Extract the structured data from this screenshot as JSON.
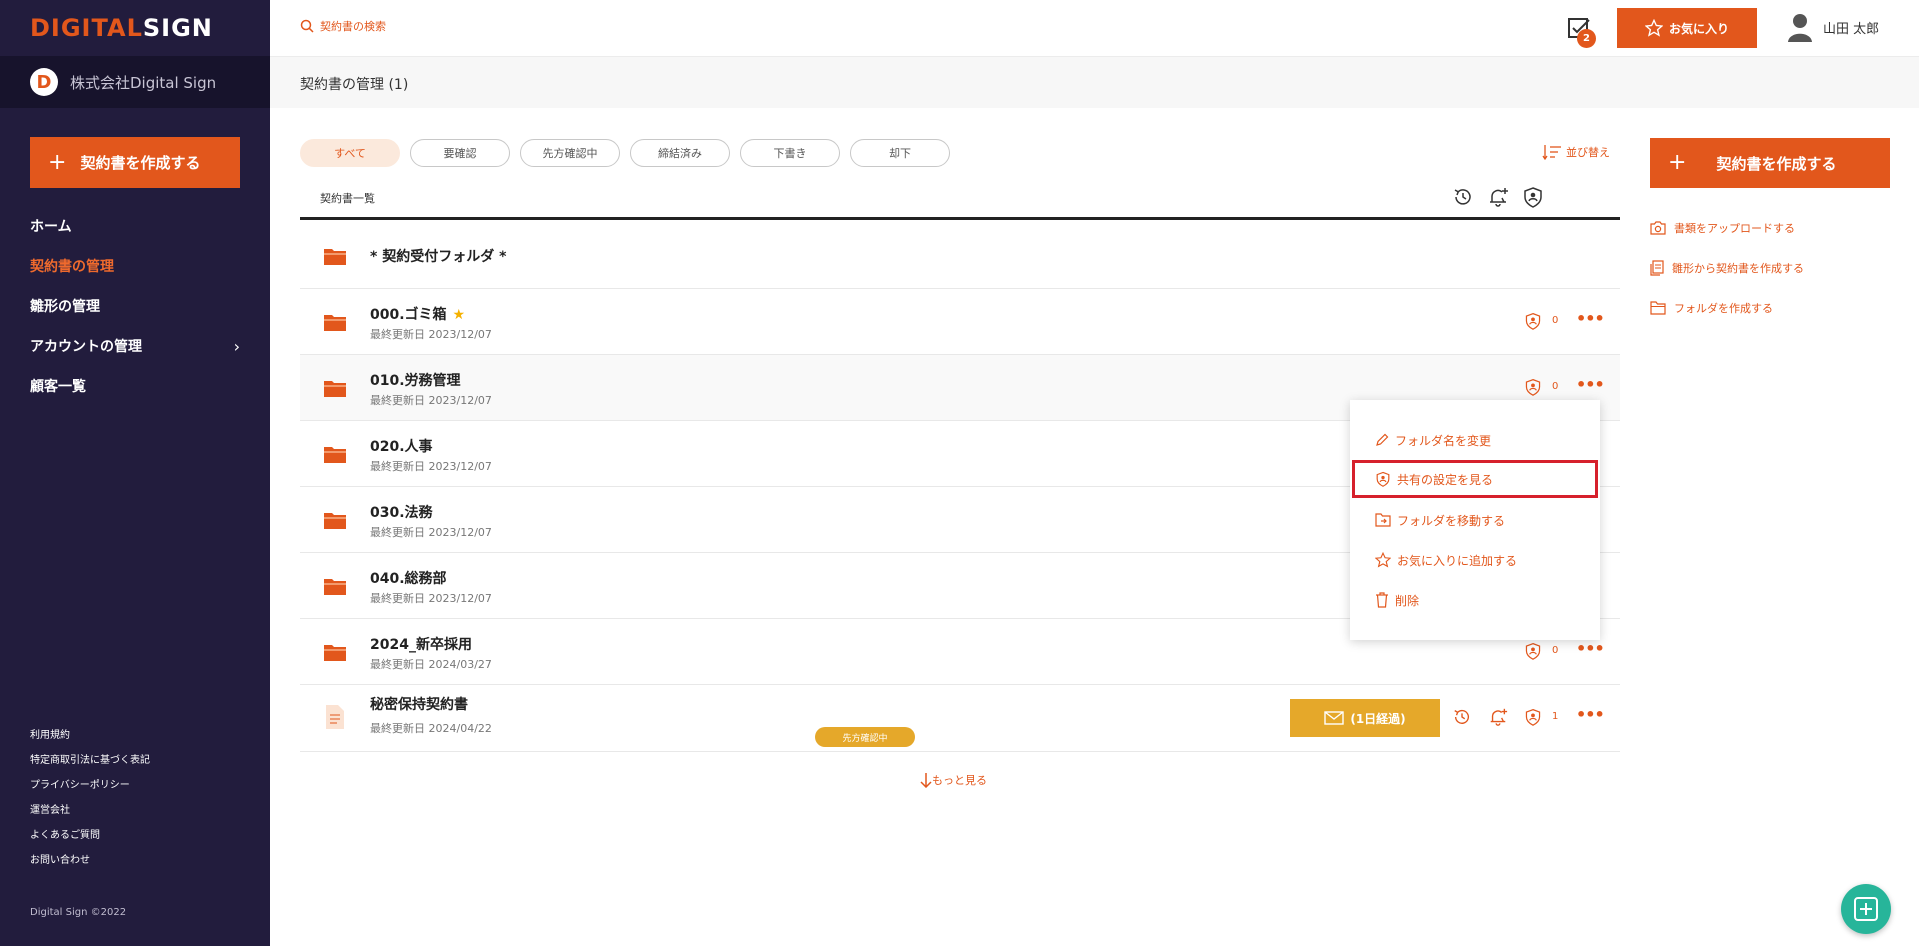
{
  "brand": {
    "logo_part1": "DIGITAL",
    "logo_part2": "SIGN",
    "company_initial": "D",
    "company_name": "株式会社Digital Sign",
    "accent_color": "#e2571c"
  },
  "sidebar": {
    "create_label": "契約書を作成する",
    "nav": [
      {
        "label": "ホーム",
        "active": false
      },
      {
        "label": "契約書の管理",
        "active": true
      },
      {
        "label": "雛形の管理",
        "active": false
      },
      {
        "label": "アカウントの管理",
        "active": false,
        "has_submenu": true
      },
      {
        "label": "顧客一覧",
        "active": false
      }
    ],
    "footer_links": [
      "利用規約",
      "特定商取引法に基づく表記",
      "プライバシーポリシー",
      "運営会社",
      "よくあるご質問",
      "お問い合わせ"
    ],
    "copyright": "Digital Sign ©2022"
  },
  "topbar": {
    "search_placeholder": "契約書の検索",
    "task_count": "2",
    "favorite_label": "お気に入り",
    "user_name": "山田 太郎"
  },
  "page": {
    "title": "契約書の管理 (1)"
  },
  "filters": [
    "すべて",
    "要確認",
    "先方確認中",
    "締結済み",
    "下書き",
    "却下"
  ],
  "sort_label": "並び替え",
  "list_header": "契約書一覧",
  "rows": [
    {
      "title": "* 契約受付フォルダ *",
      "date": ""
    },
    {
      "title": "000.ゴミ箱",
      "date": "最終更新日 2023/12/07",
      "starred": true,
      "share_count": "0"
    },
    {
      "title": "010.労務管理",
      "date": "最終更新日 2023/12/07",
      "share_count": "0"
    },
    {
      "title": "020.人事",
      "date": "最終更新日 2023/12/07",
      "share_count": "0"
    },
    {
      "title": "030.法務",
      "date": "最終更新日 2023/12/07",
      "share_count": "0"
    },
    {
      "title": "040.総務部",
      "date": "最終更新日 2023/12/07",
      "share_count": "0"
    },
    {
      "title": "2024_新卒採用",
      "date": "最終更新日 2024/03/27",
      "share_count": "0"
    },
    {
      "title": "秘密保持契約書",
      "date": "最終更新日 2024/04/22",
      "status": "先方確認中",
      "mail_label": "(1日経過)",
      "share_count": "1"
    }
  ],
  "see_more": "もっと見る",
  "context_menu": [
    "フォルダ名を変更",
    "共有の設定を見る",
    "フォルダを移動する",
    "お気に入りに追加する",
    "削除"
  ],
  "right_panel": {
    "create_label": "契約書を作成する",
    "links": [
      "書類をアップロードする",
      "雛形から契約書を作成する",
      "フォルダを作成する"
    ]
  }
}
